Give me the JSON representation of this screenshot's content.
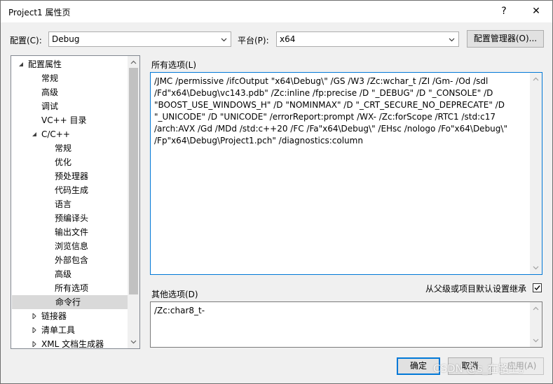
{
  "window": {
    "title": "Project1 属性页",
    "help": "?",
    "close": "✕"
  },
  "config": {
    "label": "配置(C):",
    "value": "Debug",
    "platform_label": "平台(P):",
    "platform_value": "x64",
    "manager_button": "配置管理器(O)..."
  },
  "tree": {
    "items": [
      {
        "label": "配置属性",
        "twisty": "expanded"
      },
      {
        "label": "常规"
      },
      {
        "label": "高级"
      },
      {
        "label": "调试"
      },
      {
        "label": "VC++ 目录"
      },
      {
        "label": "C/C++",
        "twisty": "expanded"
      },
      {
        "label": "常规"
      },
      {
        "label": "优化"
      },
      {
        "label": "预处理器"
      },
      {
        "label": "代码生成"
      },
      {
        "label": "语言"
      },
      {
        "label": "预编译头"
      },
      {
        "label": "输出文件"
      },
      {
        "label": "浏览信息"
      },
      {
        "label": "外部包含"
      },
      {
        "label": "高级"
      },
      {
        "label": "所有选项"
      },
      {
        "label": "命令行",
        "selected": true
      },
      {
        "label": "链接器",
        "twisty": "collapsed"
      },
      {
        "label": "清单工具",
        "twisty": "collapsed"
      },
      {
        "label": "XML 文档生成器",
        "twisty": "collapsed"
      }
    ]
  },
  "all_options": {
    "label": "所有选项(L)",
    "lines": [
      "/JMC /permissive /ifcOutput \"x64\\Debug\\\" /GS /W3 /Zc:wchar_t /ZI /Gm- /Od /sdl",
      "/Fd\"x64\\Debug\\vc143.pdb\" /Zc:inline /fp:precise /D \"_DEBUG\" /D \"_CONSOLE\" /D",
      "\"BOOST_USE_WINDOWS_H\" /D \"NOMINMAX\" /D \"_CRT_SECURE_NO_DEPRECATE\" /D",
      "\"_UNICODE\" /D \"UNICODE\" /errorReport:prompt /WX- /Zc:forScope /RTC1 /std:c17",
      "/arch:AVX /Gd /MDd /std:c++20 /FC /Fa\"x64\\Debug\\\" /EHsc /nologo /Fo\"x64\\Debug\\\"",
      "/Fp\"x64\\Debug\\Project1.pch\" /diagnostics:column"
    ]
  },
  "other_options": {
    "label": "其他选项(D)",
    "value": "/Zc:char8_t-",
    "inherit_label": "从父级或项目默认设置继承",
    "inherit_checked": true
  },
  "buttons": {
    "ok": "确定",
    "cancel": "取消",
    "apply": "应用(A)"
  },
  "watermark": "CSDN @s_在路上。"
}
